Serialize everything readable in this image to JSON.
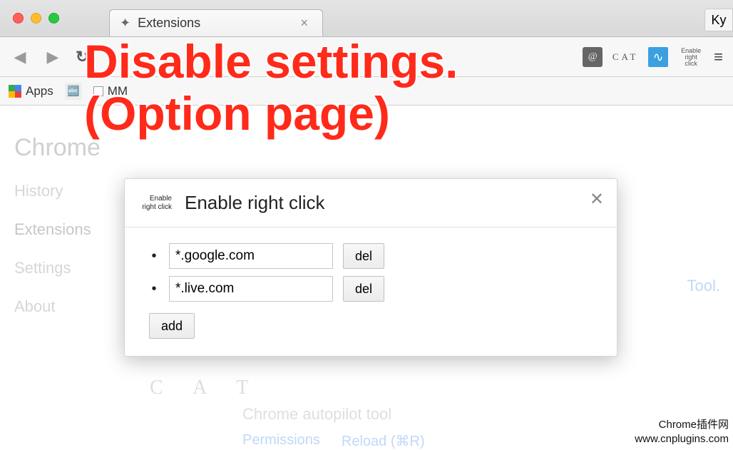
{
  "tab": {
    "title": "Extensions",
    "icon": "puzzle-icon"
  },
  "profile_label": "Ky",
  "bookmarks": {
    "apps_label": "Apps",
    "items": [
      "MM"
    ]
  },
  "sidebar": {
    "heading": "Chrome",
    "items": [
      "History",
      "Extensions",
      "Settings",
      "About"
    ],
    "selected_index": 1
  },
  "modal": {
    "logo_text": "Enable right click",
    "title": "Enable right click",
    "rows": [
      {
        "value": "*.google.com",
        "del_label": "del"
      },
      {
        "value": "*.live.com",
        "del_label": "del"
      }
    ],
    "add_label": "add"
  },
  "background": {
    "cat": "C A T",
    "subtitle": "Chrome autopilot tool",
    "links": [
      "Permissions",
      "Reload (⌘R)"
    ],
    "right_link": "Tool."
  },
  "toolbar_ext": {
    "cat_label": "CAT",
    "text_icon": "Enable right click"
  },
  "annotation": {
    "line1": "Disable settings.",
    "line2": "(Option page)"
  },
  "footer": {
    "line1": "Chrome插件网",
    "line2": "www.cnplugins.com"
  }
}
